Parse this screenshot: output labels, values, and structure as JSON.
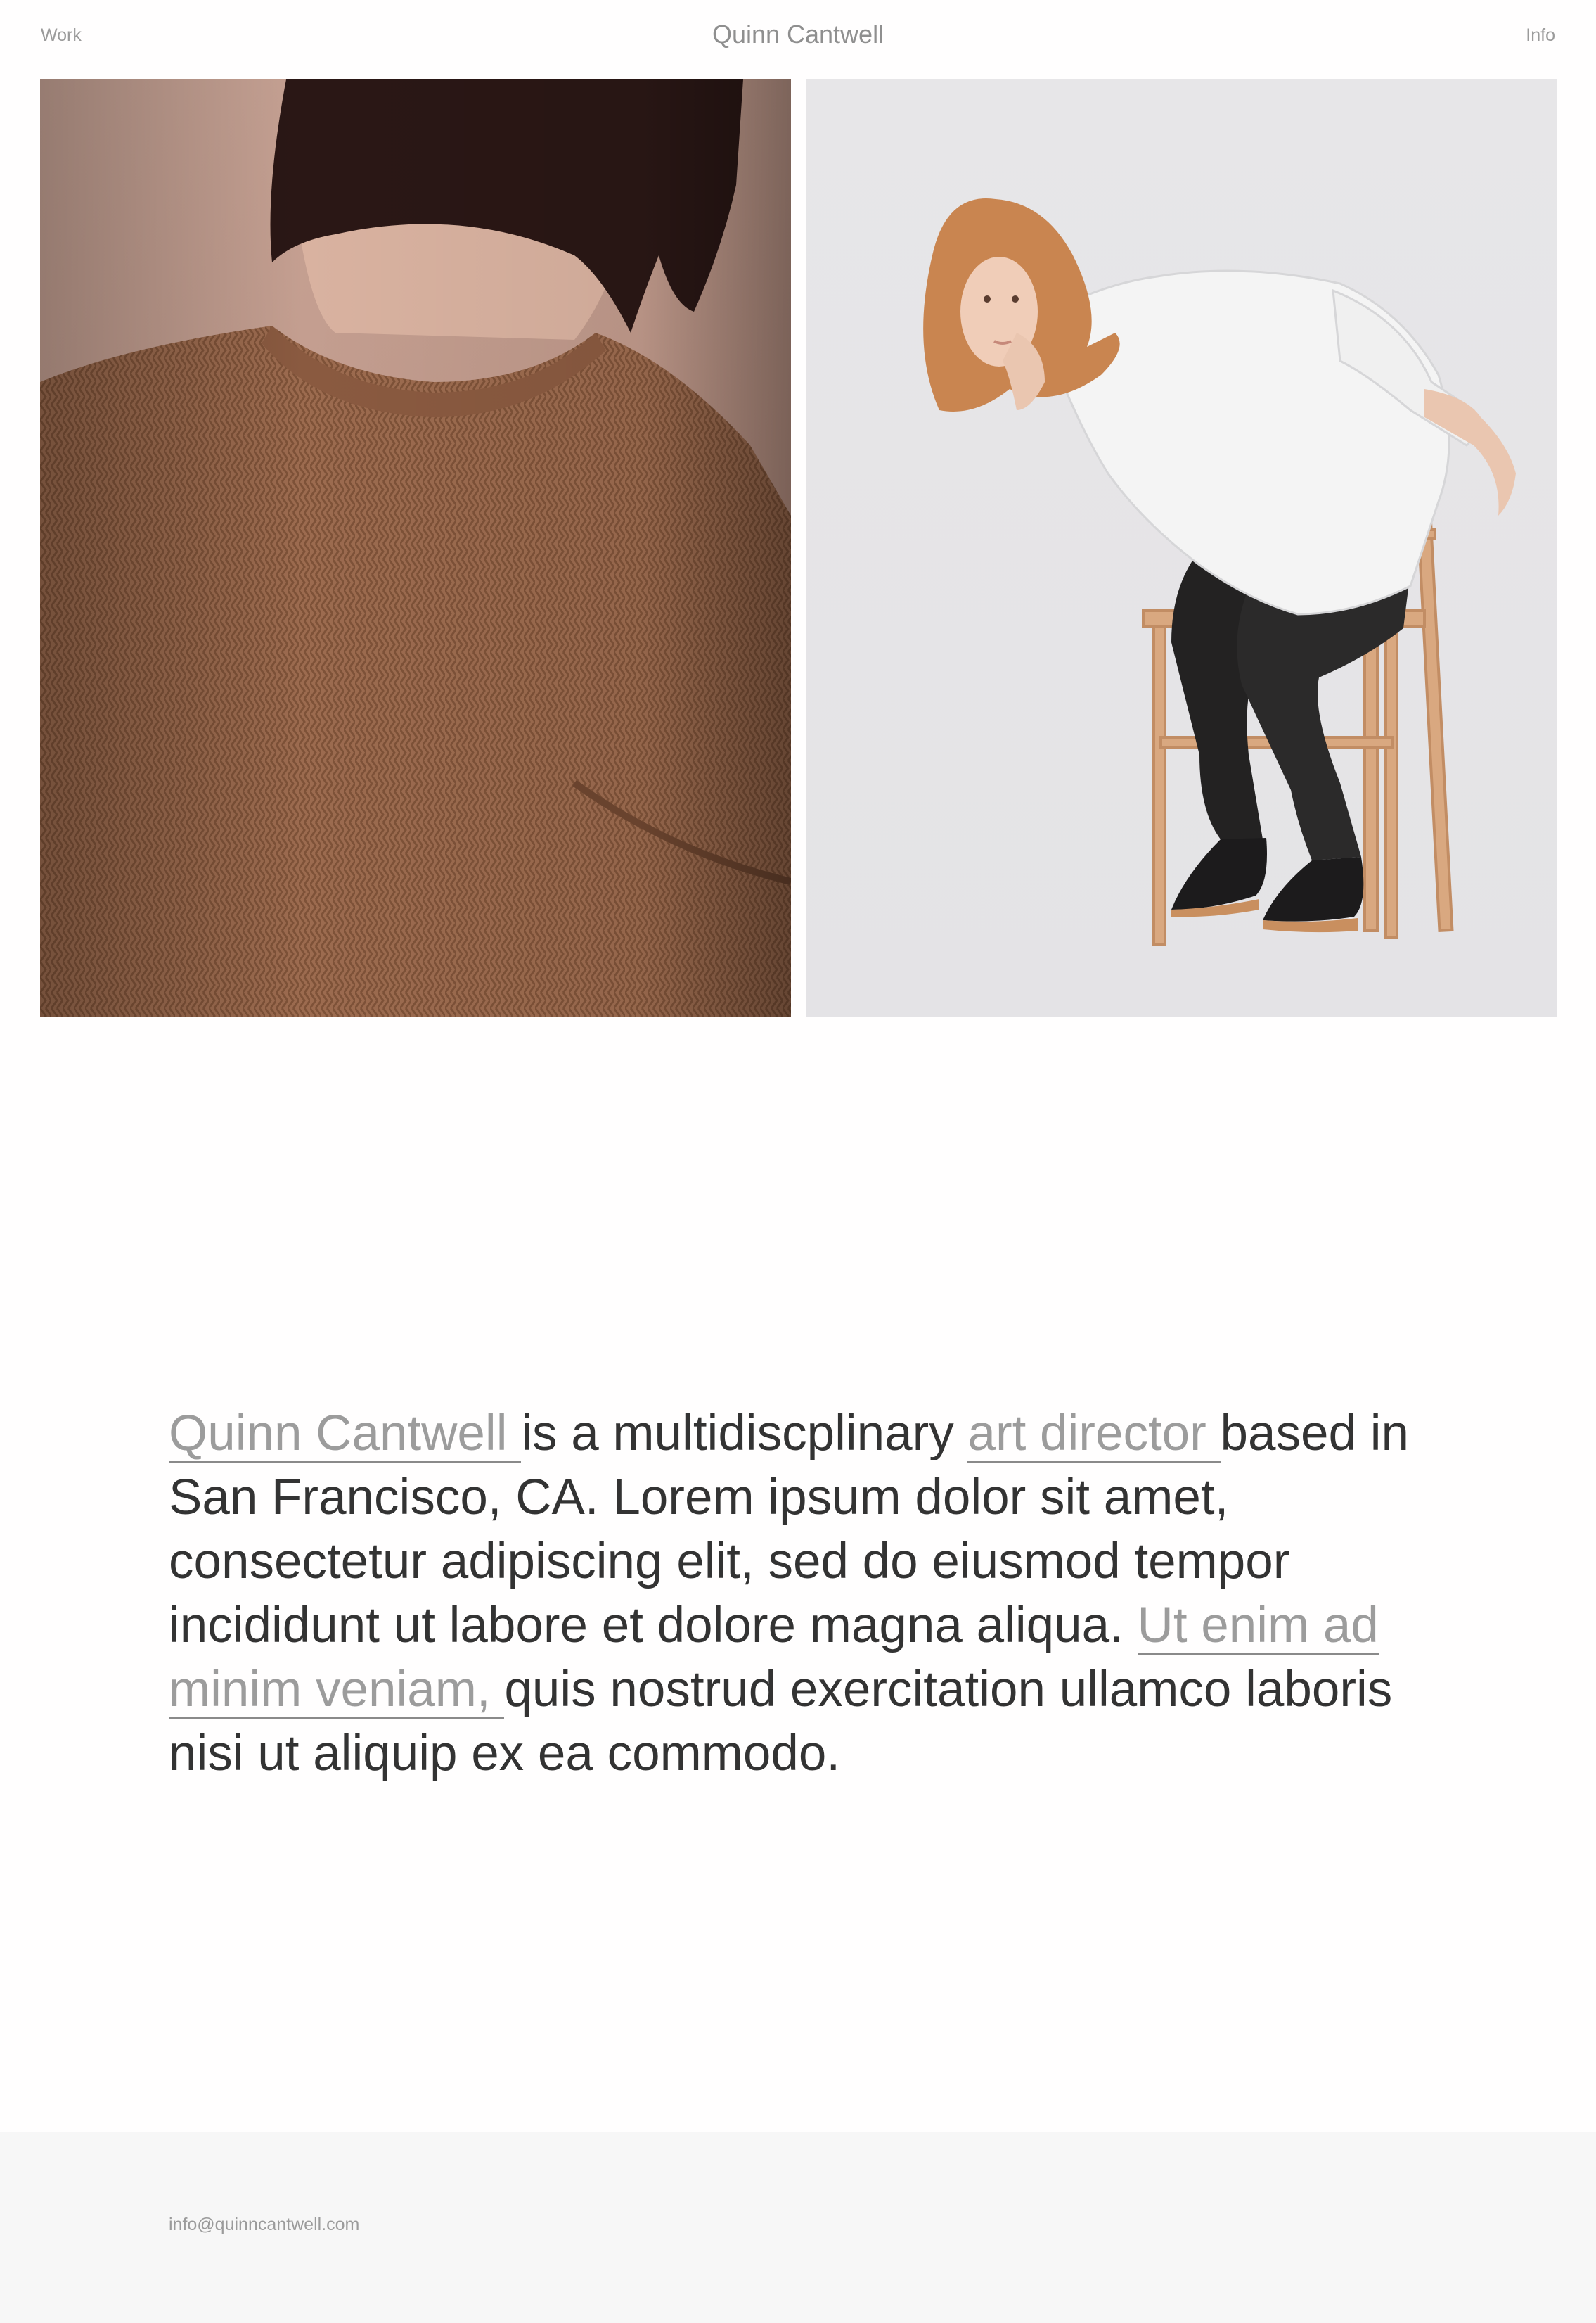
{
  "header": {
    "nav_left": "Work",
    "title": "Quinn Cantwell",
    "nav_right": "Info"
  },
  "gallery": {
    "images": [
      {
        "subject": "woman in brown knit sweater, back view"
      },
      {
        "subject": "woman in white shirt sitting on wooden chair"
      }
    ]
  },
  "bio": {
    "link_name": "Quinn Cantwell ",
    "text_1": "is a multidiscplinary ",
    "link_role": "art director ",
    "text_2": "based in San Francisco, CA. Lorem ipsum dolor sit amet, consectetur adipiscing elit, sed do eiusmod tempor incididunt ut labore et dolore magna aliqua. ",
    "link_3": "Ut enim ad minim veniam, ",
    "text_3": "quis nostrud exercitation ullamco laboris nisi ut aliquip ex ea commodo."
  },
  "footer": {
    "email": "info@quinncantwell.com"
  },
  "colors": {
    "text": "#333333",
    "muted": "#9c9c9c",
    "footer_bg": "#f7f7f7"
  }
}
